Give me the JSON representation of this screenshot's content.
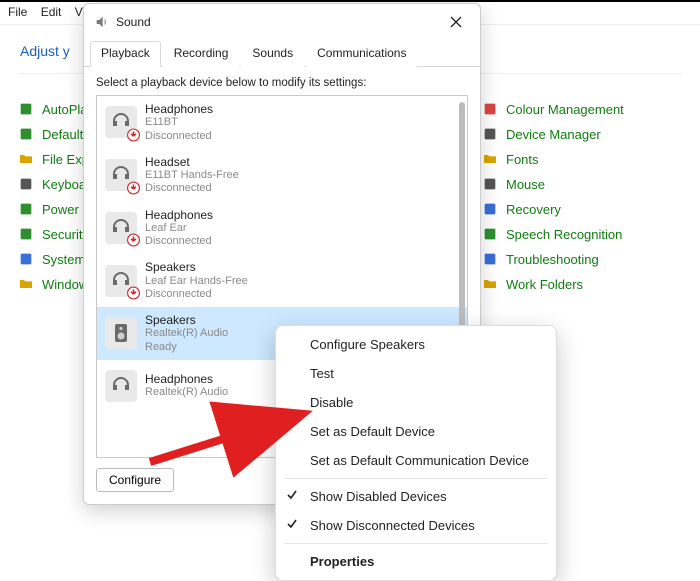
{
  "menu": {
    "file": "File",
    "edit": "Edit",
    "view_cut": "Vi"
  },
  "background": {
    "title_cut": "Adjust y",
    "stray_paren": ")",
    "left_links": [
      {
        "name": "autoplay",
        "label": "AutoPla",
        "icon_color": "#2f8f2f"
      },
      {
        "name": "default",
        "label": "Default",
        "icon_color": "#2f8f2f"
      },
      {
        "name": "file-explorer",
        "label": "File Exp",
        "icon_color": "#d9a300"
      },
      {
        "name": "keyboard",
        "label": "Keyboa",
        "icon_color": "#555"
      },
      {
        "name": "power",
        "label": "Power (",
        "icon_color": "#2f8f2f"
      },
      {
        "name": "security",
        "label": "Security",
        "icon_color": "#2f8f2f"
      },
      {
        "name": "system",
        "label": "System",
        "icon_color": "#3a6fd8"
      },
      {
        "name": "windows",
        "label": "Window",
        "icon_color": "#d9a300"
      }
    ],
    "right_links": [
      {
        "name": "colour-management",
        "label": "Colour Management",
        "icon_color": "#d44"
      },
      {
        "name": "device-manager",
        "label": "Device Manager",
        "icon_color": "#555"
      },
      {
        "name": "fonts",
        "label": "Fonts",
        "icon_color": "#d9a300"
      },
      {
        "name": "mouse",
        "label": "Mouse",
        "icon_color": "#555"
      },
      {
        "name": "recovery",
        "label": "Recovery",
        "icon_color": "#3a6fd8"
      },
      {
        "name": "speech-recognition",
        "label": "Speech Recognition",
        "icon_color": "#2f8f2f"
      },
      {
        "name": "troubleshooting",
        "label": "Troubleshooting",
        "icon_color": "#3a6fd8"
      },
      {
        "name": "work-folders",
        "label": "Work Folders",
        "icon_color": "#d9a300"
      }
    ]
  },
  "sound_dialog": {
    "title": "Sound",
    "tabs": {
      "playback": "Playback",
      "recording": "Recording",
      "sounds": "Sounds",
      "communications": "Communications"
    },
    "active_tab": "playback",
    "instruction": "Select a playback device below to modify its settings:",
    "devices": [
      {
        "name": "Headphones",
        "sub1": "E11BT",
        "sub2": "Disconnected",
        "kind": "headphones",
        "status": "down",
        "selected": false
      },
      {
        "name": "Headset",
        "sub1": "E11BT Hands-Free",
        "sub2": "Disconnected",
        "kind": "headset",
        "status": "down",
        "selected": false
      },
      {
        "name": "Headphones",
        "sub1": "Leaf Ear",
        "sub2": "Disconnected",
        "kind": "headphones",
        "status": "down",
        "selected": false
      },
      {
        "name": "Speakers",
        "sub1": "Leaf Ear Hands-Free",
        "sub2": "Disconnected",
        "kind": "headphones",
        "status": "down",
        "selected": false
      },
      {
        "name": "Speakers",
        "sub1": "Realtek(R) Audio",
        "sub2": "Ready",
        "kind": "speaker",
        "status": "ok",
        "selected": true
      },
      {
        "name": "Headphones",
        "sub1": "Realtek(R) Audio",
        "sub2": "",
        "kind": "headphones",
        "status": "none",
        "selected": false
      }
    ],
    "configure_btn": "Configure"
  },
  "context_menu": {
    "items": [
      {
        "label": "Configure Speakers",
        "checked": false,
        "bold": false
      },
      {
        "label": "Test",
        "checked": false,
        "bold": false
      },
      {
        "label": "Disable",
        "checked": false,
        "bold": false
      },
      {
        "label": "Set as Default Device",
        "checked": false,
        "bold": false
      },
      {
        "label": "Set as Default Communication Device",
        "checked": false,
        "bold": false
      }
    ],
    "items2": [
      {
        "label": "Show Disabled Devices",
        "checked": true,
        "bold": false
      },
      {
        "label": "Show Disconnected Devices",
        "checked": true,
        "bold": false
      }
    ],
    "items3": [
      {
        "label": "Properties",
        "checked": false,
        "bold": true
      }
    ]
  }
}
